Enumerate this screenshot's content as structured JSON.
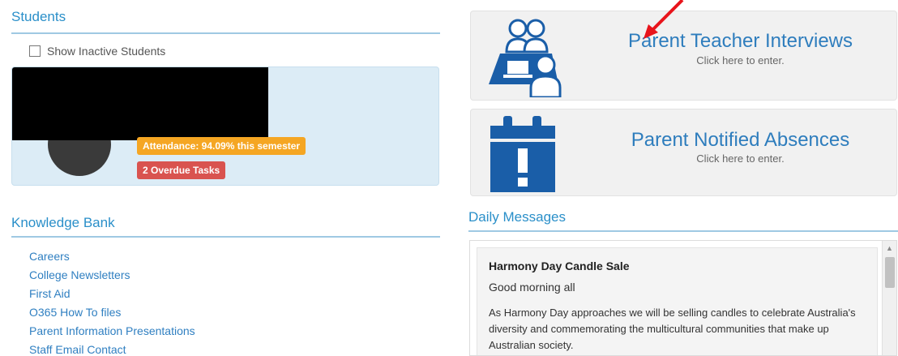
{
  "students": {
    "title": "Students",
    "show_inactive_label": "Show Inactive Students",
    "card": {
      "attendance_badge": "Attendance: 94.09% this semester",
      "overdue_badge": "2 Overdue Tasks"
    }
  },
  "knowledge_bank": {
    "title": "Knowledge Bank",
    "links": [
      "Careers",
      "College Newsletters",
      "First Aid",
      "O365 How To files",
      "Parent Information Presentations",
      "Staff Email Contact"
    ]
  },
  "tiles": {
    "interviews": {
      "title": "Parent Teacher Interviews",
      "subtitle": "Click here to enter.",
      "icon": "people-meeting-icon"
    },
    "absences": {
      "title": "Parent Notified Absences",
      "subtitle": "Click here to enter.",
      "icon": "calendar-alert-icon"
    }
  },
  "daily_messages": {
    "title": "Daily Messages",
    "message": {
      "heading": "Harmony Day Candle Sale",
      "greeting": "Good morning all",
      "body": "As Harmony Day approaches we will be selling candles to celebrate Australia's diversity and commemorating the multicultural communities that make up Australian society."
    }
  },
  "colors": {
    "accent": "#2a8fc9",
    "tile_title": "#2e7dbd",
    "attendance_badge": "#f5a623",
    "overdue_badge": "#d9534f",
    "icon_blue": "#1a5ea8",
    "annotation_arrow": "#e8141b"
  }
}
